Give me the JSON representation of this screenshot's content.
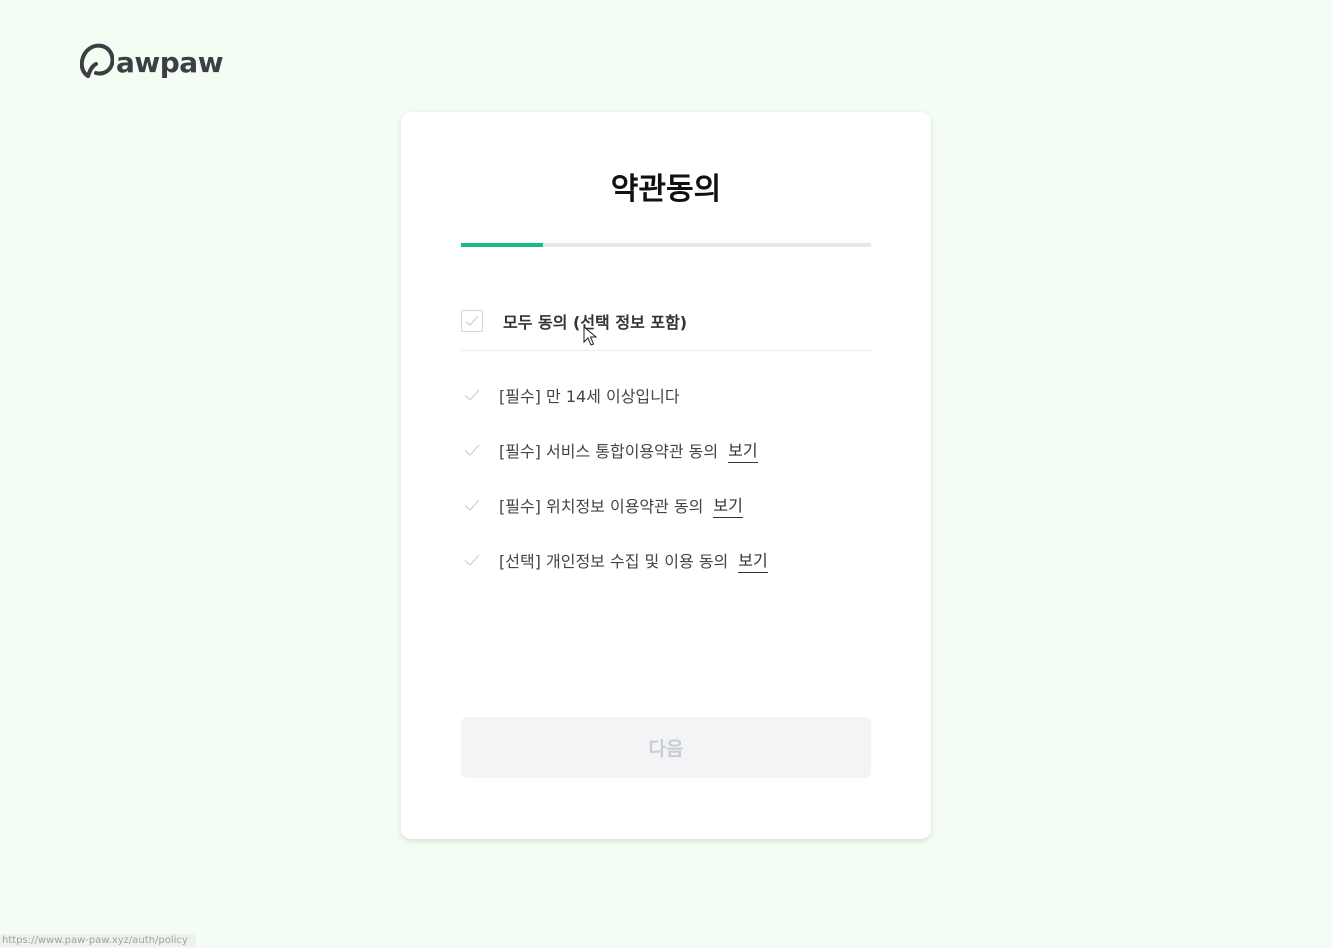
{
  "brand": {
    "name": "awpaw",
    "logo_icon": "pawpaw-logo-icon",
    "text_color": "#3b3f44"
  },
  "page": {
    "title": "약관동의",
    "progress": 0.2,
    "progress_color": "#1db889"
  },
  "agree_all": {
    "label": "모두 동의 (선택 정보 포함)",
    "checked": false
  },
  "terms": [
    {
      "label": "[필수] 만 14세 이상입니다",
      "link": ""
    },
    {
      "label": "[필수] 서비스 통합이용약관 동의",
      "link": "보기"
    },
    {
      "label": "[필수] 위치정보 이용약관 동의",
      "link": "보기"
    },
    {
      "label": "[선택] 개인정보 수집 및 이용 동의",
      "link": "보기"
    }
  ],
  "next_button": {
    "label": "다음",
    "disabled": true
  },
  "status_bar": {
    "url": "https://www.paw-paw.xyz/auth/policy"
  }
}
